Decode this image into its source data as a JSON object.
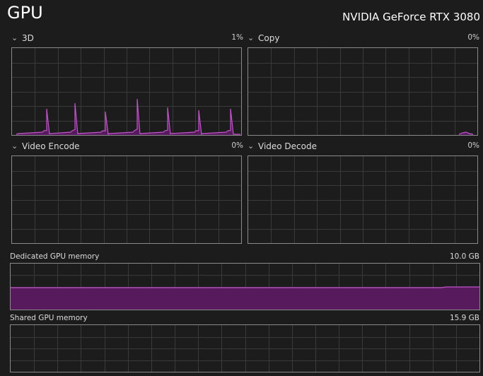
{
  "header": {
    "title": "GPU",
    "device": "NVIDIA GeForce RTX 3080"
  },
  "engines": [
    {
      "label": "3D",
      "percent": "1%"
    },
    {
      "label": "Copy",
      "percent": "0%"
    },
    {
      "label": "Video Encode",
      "percent": "0%"
    },
    {
      "label": "Video Decode",
      "percent": "0%"
    }
  ],
  "memory": {
    "dedicated": {
      "label": "Dedicated GPU memory",
      "value": "10.0 GB",
      "usage_fraction": 0.5
    },
    "shared": {
      "label": "Shared GPU memory",
      "value": "15.9 GB",
      "usage_fraction": 0.0
    }
  },
  "colors": {
    "accent": "#c155c9",
    "fill": "#561a5d",
    "grid": "#3a3a3a",
    "border": "#8a8a8a"
  },
  "icons": {
    "collapse": "chevron-down-icon"
  }
}
